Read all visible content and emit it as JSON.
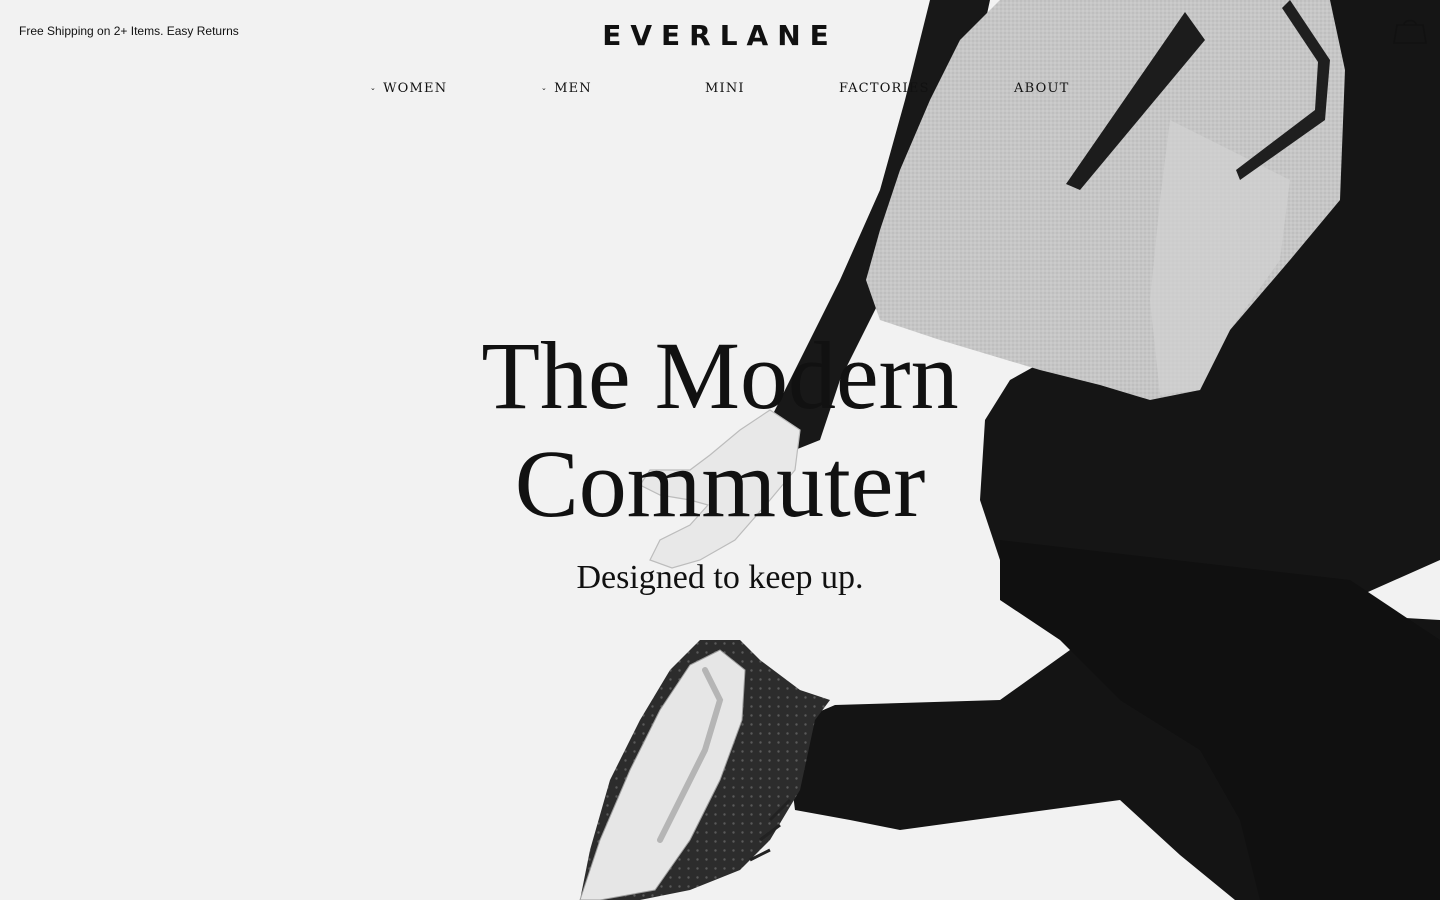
{
  "header": {
    "promo_text": "Free Shipping on 2+ Items. Easy Returns",
    "logo_text": "EVERLANE",
    "cart_icon": "shopping-bag-icon"
  },
  "nav": {
    "items": [
      {
        "label": "WOMEN",
        "has_dropdown": true
      },
      {
        "label": "MEN",
        "has_dropdown": true
      },
      {
        "label": "MINI",
        "has_dropdown": false
      },
      {
        "label": "FACTORIES",
        "has_dropdown": false
      },
      {
        "label": "ABOUT",
        "has_dropdown": false
      }
    ],
    "caret_glyph": "⌄"
  },
  "hero": {
    "headline_line1": "The Modern",
    "headline_line2": "Commuter",
    "subheadline": "Designed to keep up.",
    "image_description_icon": "commuter-with-backpack-photo"
  },
  "colors": {
    "background": "#f2f2f2",
    "text": "#111111",
    "garment": "#141414",
    "backpack": "#c9c9c9"
  }
}
